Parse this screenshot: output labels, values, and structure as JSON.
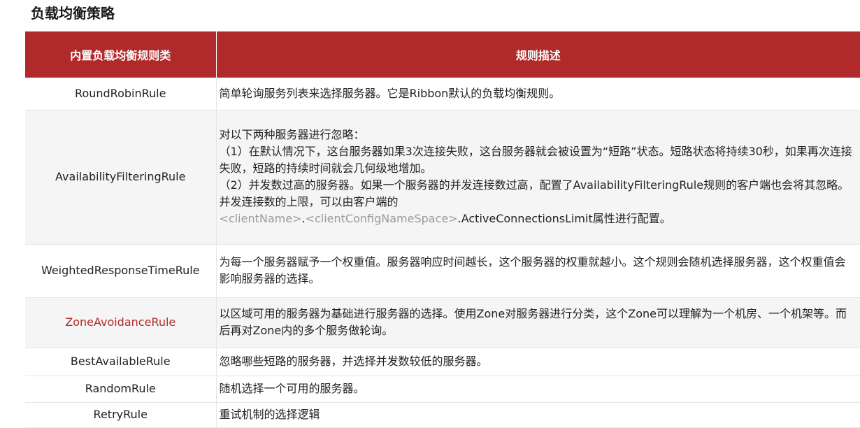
{
  "page": {
    "title": "负载均衡策略"
  },
  "colors": {
    "header_bg": "#b02a2b",
    "header_text": "#ffffff",
    "highlight_name": "#b02a2b",
    "zebra_row": "#f5f5f5",
    "muted_text": "#9a9a9a"
  },
  "table": {
    "headers": [
      "内置负载均衡规则类",
      "规则描述"
    ],
    "rows": [
      {
        "name": "RoundRobinRule",
        "desc": "简单轮询服务列表来选择服务器。它是Ribbon默认的负载均衡规则。"
      },
      {
        "name": "AvailabilityFilteringRule",
        "desc": "对以下两种服务器进行忽略：\n（1）在默认情况下，这台服务器如果3次连接失败，这台服务器就会被设置为“短路”状态。短路状态将持续30秒，如果再次连接失败，短路的持续时间就会几何级地增加。\n（2）并发数过高的服务器。如果一个服务器的并发连接数过高，配置了AvailabilityFilteringRule规则的客户端也会将其忽略。并发连接数的上限，可以由客户端的",
        "desc_placeholder_1": "<clientName>",
        "desc_dot": ".",
        "desc_placeholder_2": "<clientConfigNameSpace>",
        "desc_tail": ".ActiveConnectionsLimit属性进行配置。"
      },
      {
        "name": "WeightedResponseTimeRule",
        "desc": "为每一个服务器赋予一个权重值。服务器响应时间越长，这个服务器的权重就越小。这个规则会随机选择服务器，这个权重值会影响服务器的选择。"
      },
      {
        "name": "ZoneAvoidanceRule",
        "desc": "以区域可用的服务器为基础进行服务器的选择。使用Zone对服务器进行分类，这个Zone可以理解为一个机房、一个机架等。而后再对Zone内的多个服务做轮询。"
      },
      {
        "name": "BestAvailableRule",
        "desc": "忽略哪些短路的服务器，并选择并发数较低的服务器。"
      },
      {
        "name": "RandomRule",
        "desc": "随机选择一个可用的服务器。"
      },
      {
        "name": "RetryRule",
        "desc": "重试机制的选择逻辑"
      }
    ]
  }
}
